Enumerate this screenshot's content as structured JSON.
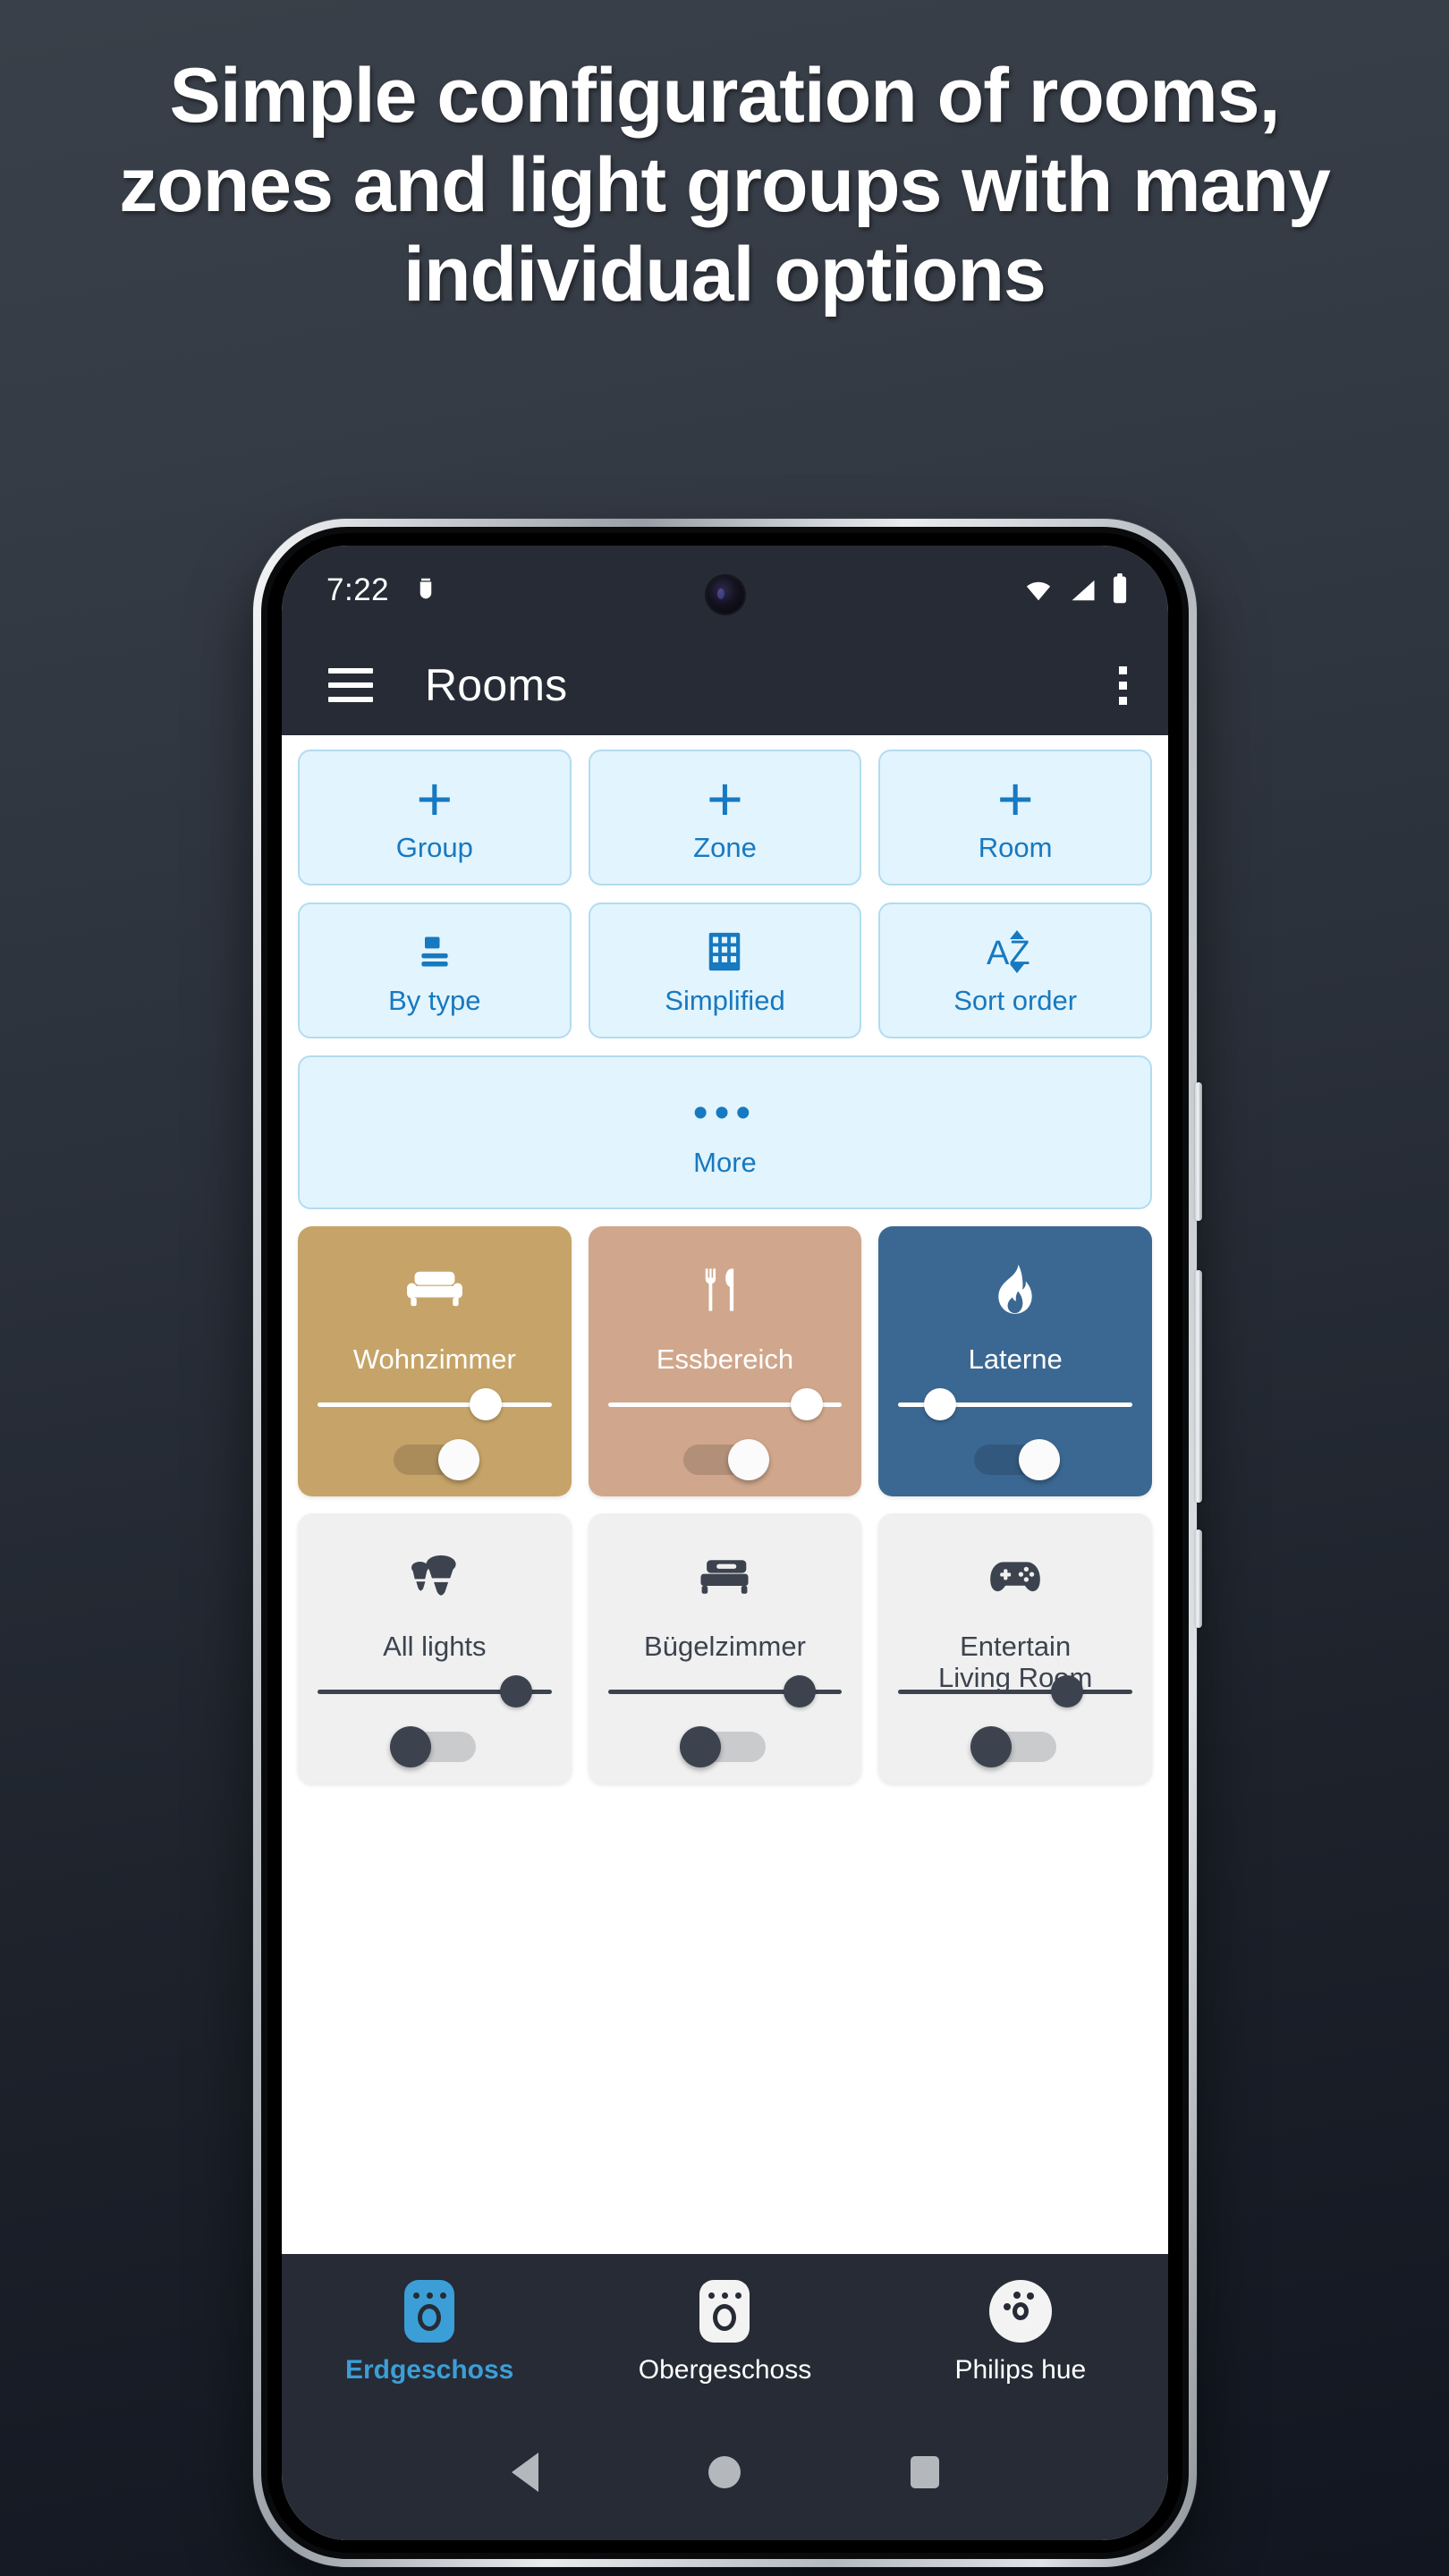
{
  "headline": "Simple configuration of rooms, zones and light groups with many individual options",
  "statusbar": {
    "time": "7:22",
    "icons": [
      "android-debug-icon",
      "wifi-icon",
      "cellular-signal-icon",
      "battery-icon"
    ]
  },
  "appbar": {
    "menu_icon": "hamburger-menu-icon",
    "title": "Rooms",
    "overflow_icon": "overflow-menu-icon"
  },
  "action_buttons": [
    {
      "label": "Group",
      "icon": "plus-icon",
      "glyph": "+"
    },
    {
      "label": "Zone",
      "icon": "plus-icon",
      "glyph": "+"
    },
    {
      "label": "Room",
      "icon": "plus-icon",
      "glyph": "+"
    },
    {
      "label": "By type",
      "icon": "list-view-icon",
      "glyph": ""
    },
    {
      "label": "Simplified",
      "icon": "grid-view-icon",
      "glyph": ""
    },
    {
      "label": "Sort order",
      "icon": "sort-az-icon",
      "glyph": "AZ"
    }
  ],
  "more_button": {
    "label": "More",
    "icon": "more-dots-icon",
    "glyph": "•••"
  },
  "rooms": [
    {
      "name": "Wohnzimmer",
      "icon": "sofa-icon",
      "color": "#c6a469",
      "text_color": "#ffffff",
      "brightness": 72,
      "power": "on",
      "style": "light"
    },
    {
      "name": "Essbereich",
      "icon": "cutlery-icon",
      "color": "#d0a78c",
      "text_color": "#ffffff",
      "brightness": 82,
      "power": "on",
      "style": "light"
    },
    {
      "name": "Laterne",
      "icon": "flame-icon",
      "color": "#3b6892",
      "text_color": "#ffffff",
      "brightness": 18,
      "power": "on",
      "style": "light"
    },
    {
      "name": "All lights",
      "icon": "bulbs-icon",
      "color": "#f0f0f1",
      "text_color": "#3c434e",
      "brightness": 85,
      "power": "off",
      "style": "grey"
    },
    {
      "name": "Bügelzimmer",
      "icon": "bed-icon",
      "color": "#f0f0f1",
      "text_color": "#3c434e",
      "brightness": 82,
      "power": "off",
      "style": "grey"
    },
    {
      "name": "Entertain\nLiving Room",
      "icon": "gamepad-icon",
      "color": "#f0f0f1",
      "text_color": "#3c434e",
      "brightness": 72,
      "power": "off",
      "style": "grey"
    }
  ],
  "bottom_nav": [
    {
      "label": "Erdgeschoss",
      "icon": "bridge-icon",
      "active": true
    },
    {
      "label": "Obergeschoss",
      "icon": "bridge-icon",
      "active": false
    },
    {
      "label": "Philips hue",
      "icon": "hue-icon",
      "active": false
    }
  ],
  "android_nav": [
    {
      "name": "back-button",
      "icon": "triangle-back-icon"
    },
    {
      "name": "home-button",
      "icon": "circle-home-icon"
    },
    {
      "name": "recents-button",
      "icon": "square-recents-icon"
    }
  ],
  "colors": {
    "accent_blue": "#1779c0",
    "button_fill": "#e2f4fd",
    "button_border": "#b3dcf0",
    "appbar": "#262b35",
    "nav_active": "#3c9ed6"
  }
}
